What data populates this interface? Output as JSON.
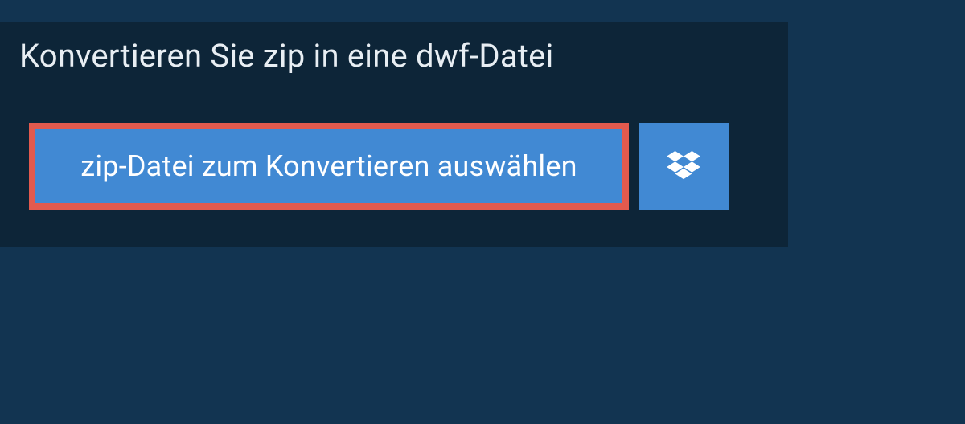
{
  "heading": "Konvertieren Sie zip in eine dwf-Datei",
  "select_button_label": "zip-Datei zum Konvertieren auswählen",
  "icons": {
    "dropbox": "dropbox-icon"
  },
  "colors": {
    "page_bg": "#123451",
    "panel_bg": "#0d2538",
    "button_bg": "#4189d3",
    "button_border_highlight": "#e25a4e",
    "text_light": "#ffffff"
  }
}
